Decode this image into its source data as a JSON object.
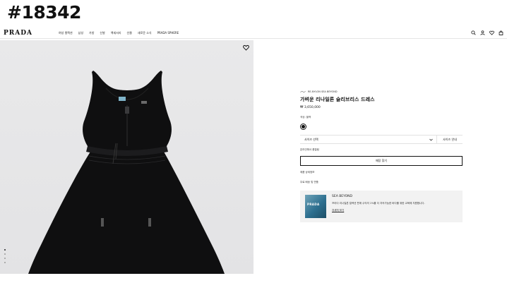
{
  "watermark": "#18342",
  "nav": {
    "logo": "PRADA",
    "menu": [
      "여성 컬렉션",
      "남성",
      "가방",
      "신발",
      "액세서리",
      "선물",
      "새로운 소식",
      "PRADA SPHERE"
    ]
  },
  "product": {
    "collection_label": "RE-NYLON SEA BEYOND",
    "title": "가벼운 리나일론 슬리브리스 드레스",
    "price": "₩ 3,650,000",
    "color_label": "색상: 블랙",
    "size_select_label": "사이즈 선택",
    "size_guide_label": "사이즈 안내",
    "stock_check": "온라인에서 품절됨",
    "store_button": "매장 찾기",
    "details_link": "제품 상세정보",
    "shipping_link": "무료 배송 및 반품"
  },
  "promo": {
    "thumb_text": "PRADA",
    "title": "SEA BEYOND",
    "description": "프라다 리나일론 컬렉션 판매 수익의 1%를 더 지속가능한 바다를 위한 교육에 지원합니다.",
    "link": "자세히 보기"
  },
  "gallery": {
    "total_images": 4,
    "active_index": 0
  },
  "colors": {
    "accent": "#111111",
    "promo_bg": "#f2f2f2",
    "photo_bg": "#e6e6e8",
    "dress": "#0f0f10"
  }
}
